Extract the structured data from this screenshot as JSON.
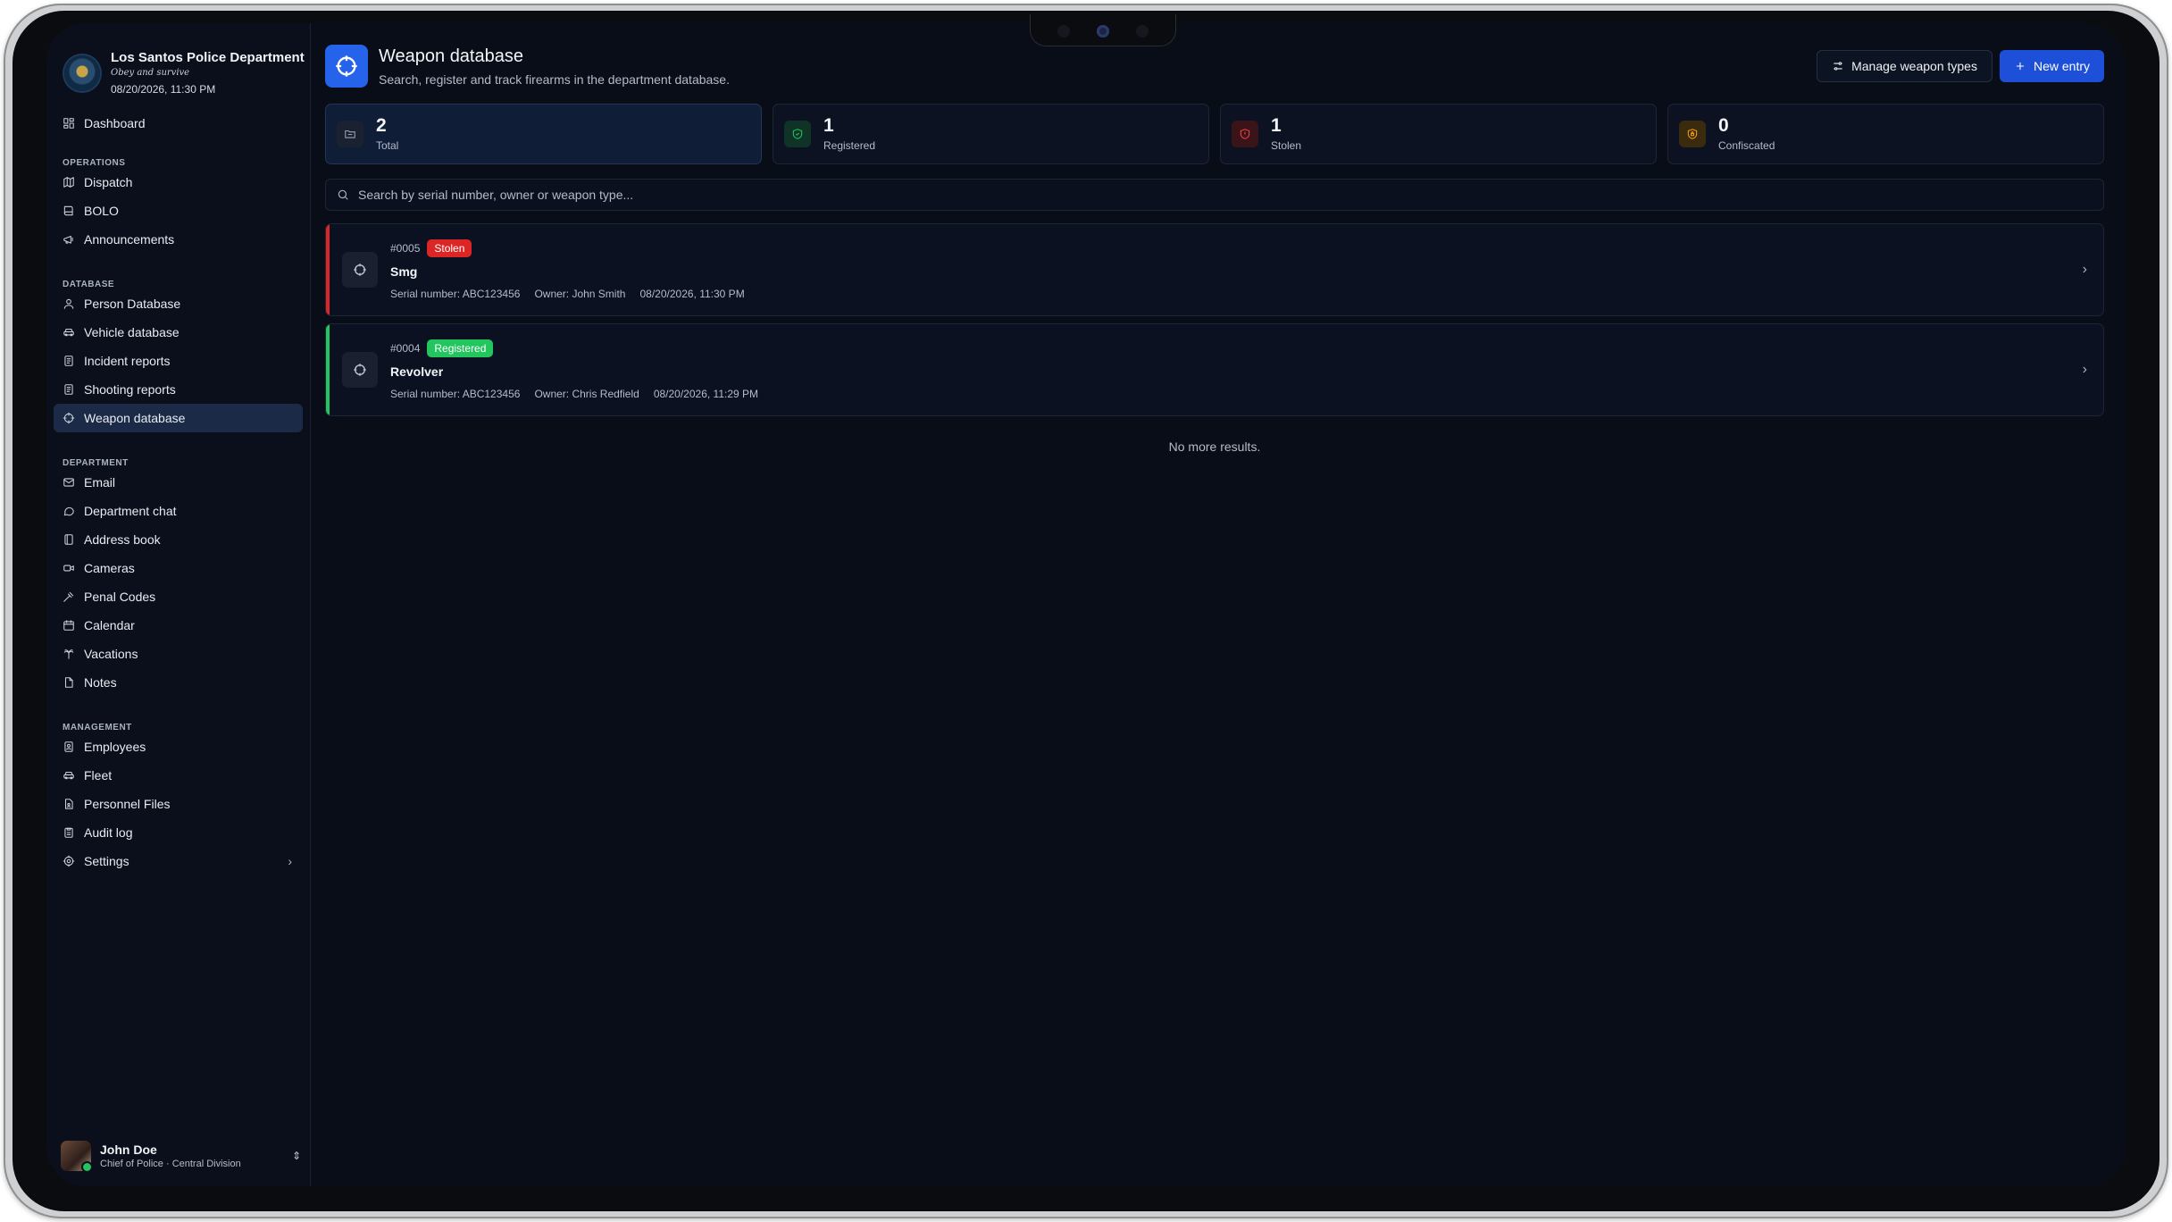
{
  "org": {
    "name": "Los Santos Police Department",
    "motto": "Obey and survive",
    "datetime": "08/20/2026, 11:30 PM"
  },
  "nav": {
    "dashboard": "Dashboard",
    "sections": {
      "operations": "OPERATIONS",
      "database": "DATABASE",
      "department": "DEPARTMENT",
      "management": "MANAGEMENT"
    },
    "operations": [
      "Dispatch",
      "BOLO",
      "Announcements"
    ],
    "database": [
      "Person Database",
      "Vehicle database",
      "Incident reports",
      "Shooting reports",
      "Weapon database"
    ],
    "department": [
      "Email",
      "Department chat",
      "Address book",
      "Cameras",
      "Penal Codes",
      "Calendar",
      "Vacations",
      "Notes"
    ],
    "management": [
      "Employees",
      "Fleet",
      "Personnel Files",
      "Audit log",
      "Settings"
    ]
  },
  "user": {
    "name": "John Doe",
    "role": "Chief of Police · Central Division"
  },
  "header": {
    "title": "Weapon database",
    "subtitle": "Search, register and track firearms in the department database.",
    "manage_label": "Manage weapon types",
    "new_label": "New entry"
  },
  "stats": [
    {
      "value": "2",
      "label": "Total"
    },
    {
      "value": "1",
      "label": "Registered"
    },
    {
      "value": "1",
      "label": "Stolen"
    },
    {
      "value": "0",
      "label": "Confiscated"
    }
  ],
  "search": {
    "placeholder": "Search by serial number, owner or weapon type..."
  },
  "entries": [
    {
      "id": "#0005",
      "status": "Stolen",
      "name": "Smg",
      "serial": "Serial number: ABC123456",
      "owner": "Owner: John Smith",
      "date": "08/20/2026, 11:30 PM"
    },
    {
      "id": "#0004",
      "status": "Registered",
      "name": "Revolver",
      "serial": "Serial number: ABC123456",
      "owner": "Owner: Chris Redfield",
      "date": "08/20/2026, 11:29 PM"
    }
  ],
  "list_footer": "No more results.",
  "colors": {
    "accent": "#2563eb",
    "stolen": "#dc2626",
    "registered": "#22c55e",
    "confiscated": "#f59e0b"
  }
}
